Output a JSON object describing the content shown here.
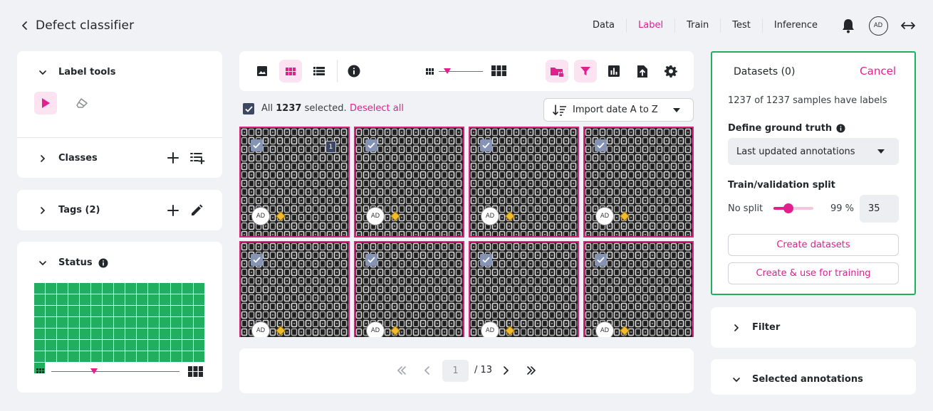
{
  "header": {
    "title": "Defect classifier",
    "nav": [
      {
        "label": "Data",
        "active": false
      },
      {
        "label": "Label",
        "active": true
      },
      {
        "label": "Train",
        "active": false
      },
      {
        "label": "Test",
        "active": false
      },
      {
        "label": "Inference",
        "active": false
      }
    ],
    "avatar": "AD"
  },
  "left": {
    "label_tools": "Label tools",
    "classes": "Classes",
    "tags": "Tags (2)",
    "status": "Status"
  },
  "toolbar": {
    "selected_prefix": "All",
    "selected_count": "1237",
    "selected_suffix": "selected.",
    "deselect": "Deselect all",
    "sort": "Import date A to Z",
    "thumb_size_level": 0.2
  },
  "tiles": [
    {
      "avatar": "AD",
      "badge": "1"
    },
    {
      "avatar": "AD",
      "badge": ""
    },
    {
      "avatar": "AD",
      "badge": ""
    },
    {
      "avatar": "AD",
      "badge": ""
    },
    {
      "avatar": "AD",
      "badge": ""
    },
    {
      "avatar": "AD",
      "badge": ""
    },
    {
      "avatar": "AD",
      "badge": ""
    },
    {
      "avatar": "AD",
      "badge": ""
    }
  ],
  "pagination": {
    "current": "1",
    "total": "/ 13"
  },
  "datasets": {
    "title": "Datasets (0)",
    "cancel": "Cancel",
    "info": "1237 of 1237 samples have labels",
    "ground_truth_label": "Define ground truth",
    "ground_truth_value": "Last updated annotations",
    "split_label": "Train/validation split",
    "no_split": "No split",
    "split_pct": "99 %",
    "split_value": "35",
    "split_level": 0.38,
    "create": "Create datasets",
    "create_train": "Create & use for training"
  },
  "filter": "Filter",
  "selected_annotations": "Selected annotations",
  "colors": {
    "accent": "#e1208e",
    "status_green": "#21ae5e",
    "tile_border": "#d8247f"
  }
}
